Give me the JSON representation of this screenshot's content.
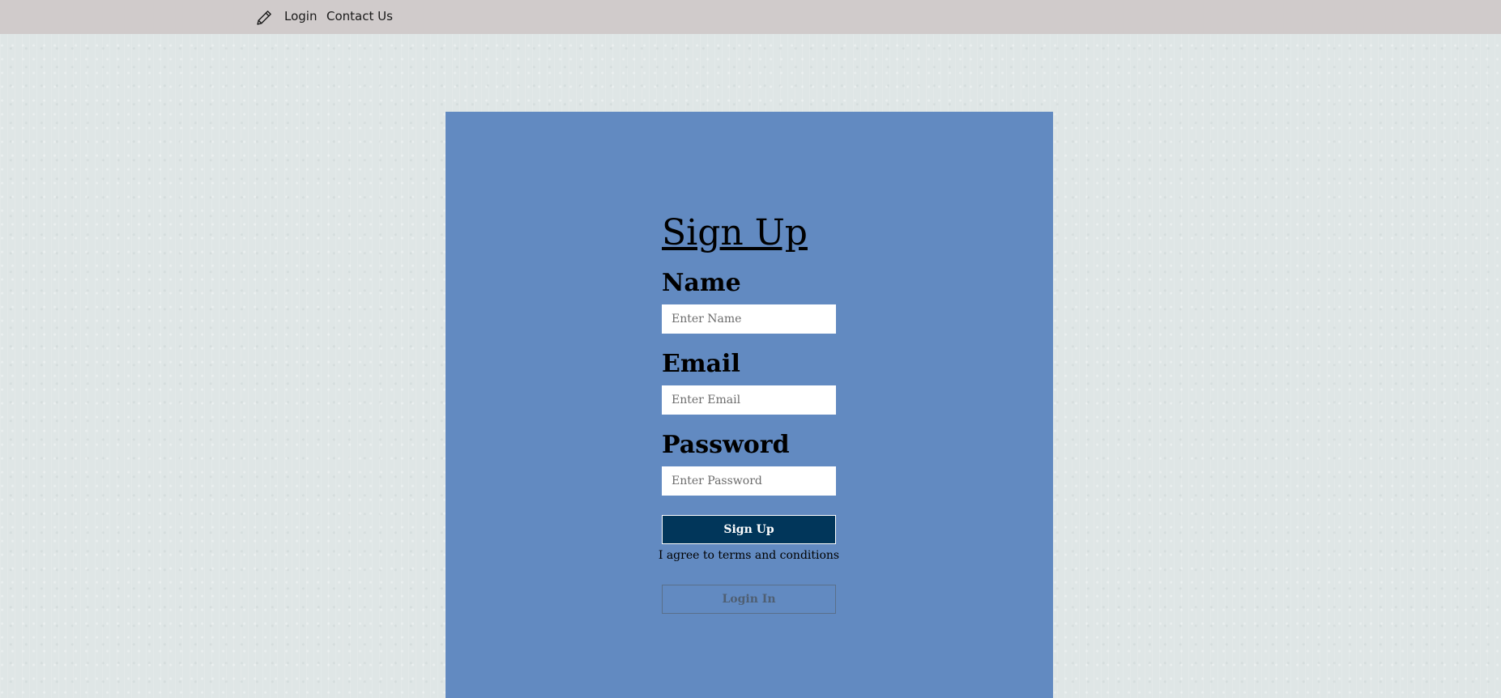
{
  "nav": {
    "brand_icon": "pencil-icon",
    "links": [
      {
        "label": "Login"
      },
      {
        "label": "Contact Us"
      }
    ]
  },
  "form": {
    "title": "Sign Up",
    "fields": [
      {
        "label": "Name",
        "placeholder": "Enter Name",
        "value": ""
      },
      {
        "label": "Email",
        "placeholder": "Enter Email",
        "value": ""
      },
      {
        "label": "Password",
        "placeholder": "Enter Password",
        "value": ""
      }
    ],
    "signup_label": "Sign Up",
    "terms_text": "I agree to terms and conditions",
    "login_label": "Login In"
  },
  "colors": {
    "navbar_bg": "#d0cbcb",
    "panel_bg": "#628ac1",
    "signup_button_bg": "#01365a",
    "page_bg": "#dfe6e6"
  }
}
